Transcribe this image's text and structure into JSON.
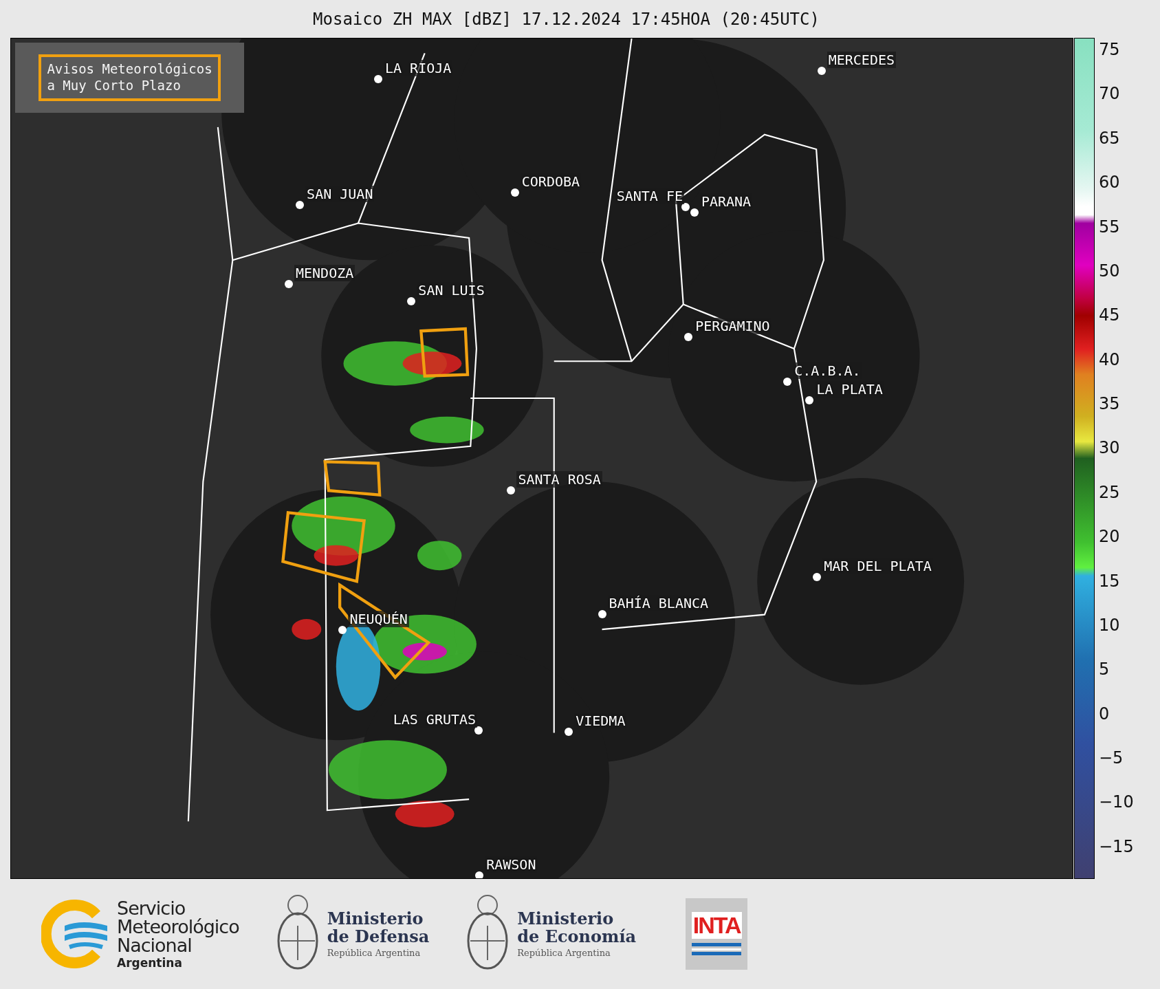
{
  "title": "Mosaico ZH MAX [dBZ] 17.12.2024 17:45HOA (20:45UTC)",
  "legend": {
    "lines": [
      "Avisos Meteorológicos",
      "a Muy Corto Plazo"
    ]
  },
  "cities": [
    {
      "name": "LA RIOJA"
    },
    {
      "name": "MERCEDES"
    },
    {
      "name": "SAN JUAN"
    },
    {
      "name": "CORDOBA"
    },
    {
      "name": "SANTA FE"
    },
    {
      "name": "PARANA"
    },
    {
      "name": "MENDOZA"
    },
    {
      "name": "SAN LUIS"
    },
    {
      "name": "PERGAMINO"
    },
    {
      "name": "C.A.B.A."
    },
    {
      "name": "LA PLATA"
    },
    {
      "name": "SANTA ROSA"
    },
    {
      "name": "MAR DEL PLATA"
    },
    {
      "name": "BAHÍA BLANCA"
    },
    {
      "name": "NEUQUÉN"
    },
    {
      "name": "LAS GRUTAS"
    },
    {
      "name": "VIEDMA"
    },
    {
      "name": "RAWSON"
    }
  ],
  "colorbar": {
    "ticks": [
      "75",
      "70",
      "65",
      "60",
      "55",
      "50",
      "45",
      "40",
      "35",
      "30",
      "25",
      "20",
      "15",
      "10",
      "5",
      "0",
      "−5",
      "−10",
      "−15"
    ]
  },
  "logos": [
    {
      "kind": "smn",
      "lines": [
        "Servicio",
        "Meteorológico",
        "Nacional"
      ],
      "subtitle": "Argentina"
    },
    {
      "kind": "ministry",
      "lines": [
        "Ministerio",
        "de Defensa"
      ],
      "subtitle": "República Argentina"
    },
    {
      "kind": "ministry",
      "lines": [
        "Ministerio",
        "de Economía"
      ],
      "subtitle": "República Argentina"
    },
    {
      "kind": "inta",
      "text": "INTA"
    }
  ]
}
